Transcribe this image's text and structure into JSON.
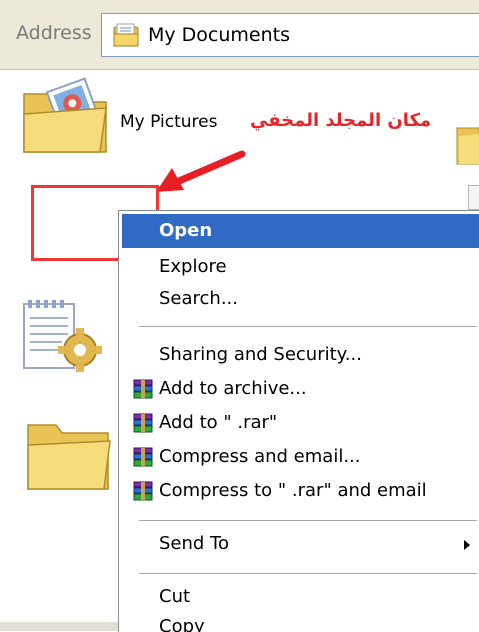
{
  "address_bar": {
    "label": "Address",
    "location": "My Documents",
    "location_icon": "my-documents-folder-icon"
  },
  "desktop": {
    "items": [
      {
        "label": "My Pictures",
        "icon": "my-pictures-folder-icon"
      },
      {
        "label": "",
        "icon": "folder-icon"
      },
      {
        "label": "",
        "icon": "notepad-settings-icon"
      },
      {
        "label": "",
        "icon": "folder-icon"
      }
    ]
  },
  "annotation": {
    "text": "مكان المجلد المخفي",
    "color": "#e4262a"
  },
  "context_menu": {
    "highlight_color": "#316ac5",
    "items": [
      {
        "label": "Open",
        "highlighted": true
      },
      {
        "label": "Explore"
      },
      {
        "label": "Search..."
      },
      {
        "label": "Sharing and Security..."
      },
      {
        "label": "Add to archive...",
        "icon": "winrar-icon"
      },
      {
        "label": "Add to \" .rar\"",
        "icon": "winrar-icon"
      },
      {
        "label": "Compress and email...",
        "icon": "winrar-icon"
      },
      {
        "label": "Compress to \" .rar\" and email",
        "icon": "winrar-icon"
      },
      {
        "label": "Send To",
        "submenu": true
      },
      {
        "label": "Cut"
      },
      {
        "label": "Copy"
      }
    ]
  }
}
